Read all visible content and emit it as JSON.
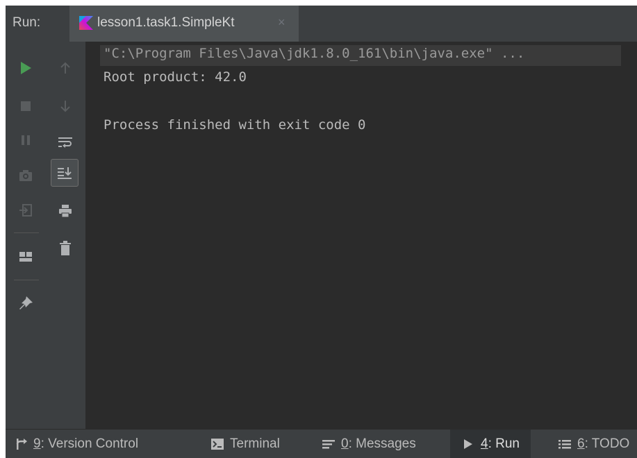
{
  "header": {
    "run_label": "Run:",
    "tab": {
      "title": "lesson1.task1.SimpleKt",
      "close": "×",
      "icon": "kotlin-icon"
    }
  },
  "toolbar_primary": [
    {
      "icon": "run-icon",
      "color": "#499c54"
    },
    {
      "icon": "stop-icon",
      "color": "#5a5d5f"
    },
    {
      "icon": "pause-icon",
      "color": "#5a5d5f"
    },
    {
      "icon": "camera-icon",
      "color": "#5a5d5f"
    },
    {
      "icon": "exit-icon",
      "color": "#5a5d5f"
    },
    {
      "icon": "layout-icon",
      "color": "#afb1b3"
    },
    {
      "icon": "pin-icon",
      "color": "#afb1b3"
    }
  ],
  "toolbar_secondary": [
    {
      "icon": "arrow-up-icon",
      "color": "#5a5d5f"
    },
    {
      "icon": "arrow-down-icon",
      "color": "#5a5d5f"
    },
    {
      "icon": "soft-wrap-icon",
      "color": "#afb1b3"
    },
    {
      "icon": "scroll-to-end-icon",
      "color": "#afb1b3"
    },
    {
      "icon": "print-icon",
      "color": "#afb1b3"
    },
    {
      "icon": "trash-icon",
      "color": "#afb1b3"
    }
  ],
  "console": {
    "command": "\"C:\\Program Files\\Java\\jdk1.8.0_161\\bin\\java.exe\" ...",
    "output_line": "Root product: 42.0",
    "exit_line": "Process finished with exit code 0"
  },
  "bottom_bar": {
    "version_control": {
      "num": "9",
      "label": ": Version Control"
    },
    "terminal": {
      "label": "Terminal"
    },
    "messages": {
      "num": "0",
      "label": ": Messages"
    },
    "run": {
      "num": "4",
      "label": ": Run"
    },
    "todo": {
      "num": "6",
      "label": ": TODO"
    }
  }
}
